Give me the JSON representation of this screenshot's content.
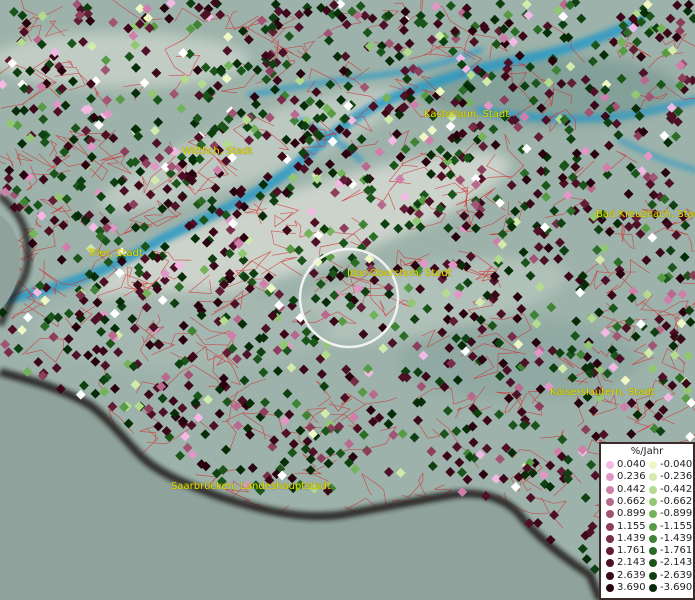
{
  "cities": [
    {
      "name": "Kastellaun, Stadt",
      "id": "kastellaun"
    },
    {
      "name": "Wittlich, Stadt",
      "id": "wittlich"
    },
    {
      "name": "Bad Kreuznach, Stadt",
      "id": "bad-kreuznach"
    },
    {
      "name": "Trier, Stadt",
      "id": "trier"
    },
    {
      "name": "Idar-Oberstein, Stadt",
      "id": "idar-oberstein"
    },
    {
      "name": "Kaiserslautern, Stadt",
      "id": "kaiserslautern"
    },
    {
      "name": "Saarbrücken, Landeshauptstadt",
      "id": "saarbruecken"
    }
  ],
  "legend": {
    "title": "%/Jahr",
    "positive": [
      {
        "label": "0.040",
        "color": "#f4b8e4"
      },
      {
        "label": "0.236",
        "color": "#e296c8"
      },
      {
        "label": "0.442",
        "color": "#d07fab"
      },
      {
        "label": "0.662",
        "color": "#b86a8e"
      },
      {
        "label": "0.899",
        "color": "#a25474"
      },
      {
        "label": "1.155",
        "color": "#8c3e5c"
      },
      {
        "label": "1.439",
        "color": "#772c47"
      },
      {
        "label": "1.761",
        "color": "#621c35"
      },
      {
        "label": "2.143",
        "color": "#4e1026"
      },
      {
        "label": "2.639",
        "color": "#3b0719"
      },
      {
        "label": "3.690",
        "color": "#28020e"
      }
    ],
    "negative": [
      {
        "label": "-0.040",
        "color": "#eef7c4"
      },
      {
        "label": "-0.236",
        "color": "#d2ebaa"
      },
      {
        "label": "-0.442",
        "color": "#b4dc8e"
      },
      {
        "label": "-0.662",
        "color": "#93c873"
      },
      {
        "label": "-0.899",
        "color": "#74b35a"
      },
      {
        "label": "-1.155",
        "color": "#579b45"
      },
      {
        "label": "-1.439",
        "color": "#3f8334"
      },
      {
        "label": "-1.761",
        "color": "#2b6c26"
      },
      {
        "label": "-2.143",
        "color": "#1b551b"
      },
      {
        "label": "-2.639",
        "color": "#0f4011"
      },
      {
        "label": "-3.690",
        "color": "#062c08"
      }
    ]
  },
  "colors": {
    "terrain": "#9fb4ad",
    "water": "#2c9ac4",
    "border": "#d23232",
    "label": "#e8e000",
    "land_shadow": "#1c1414",
    "zero_point": "#ffffff"
  }
}
